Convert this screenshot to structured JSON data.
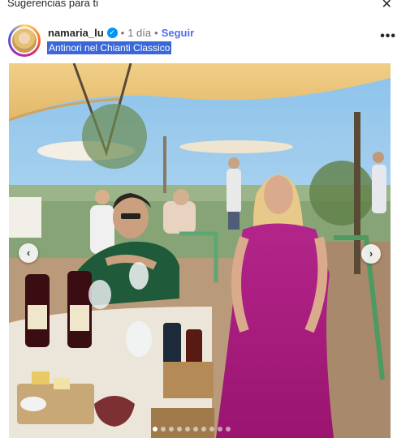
{
  "panel": {
    "title": "Sugerencias para ti",
    "close_glyph": "✕"
  },
  "post": {
    "username": "namaria_lu",
    "verified_glyph": "✓",
    "separator": "•",
    "time": "1 día",
    "follow_label": "Seguir",
    "location": "Antinori nel Chianti Classico",
    "more_glyph": "•••"
  },
  "carousel": {
    "prev_glyph": "‹",
    "next_glyph": "›",
    "slide_count": 10,
    "active_index": 0
  },
  "colors": {
    "follow": "#4f6df5",
    "location_highlight": "#3b68d9",
    "verified": "#0095f6",
    "dress": "#b0197e"
  }
}
